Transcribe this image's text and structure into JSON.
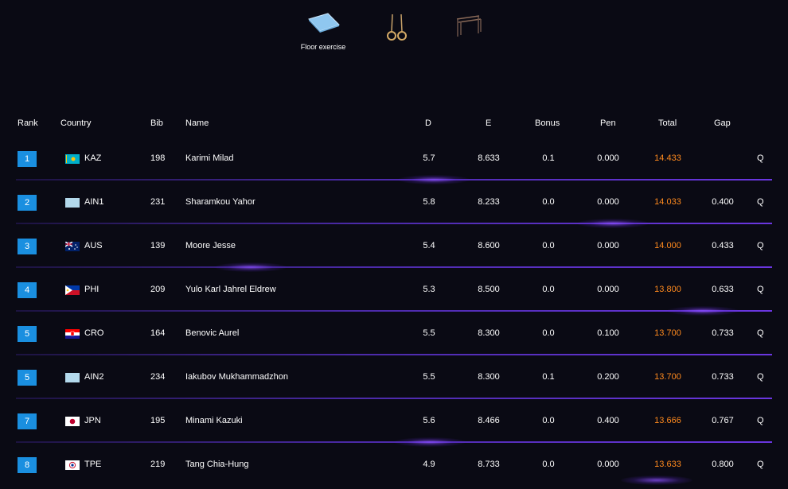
{
  "apparatus": {
    "items": [
      {
        "id": "floor",
        "label": "Floor exercise",
        "icon": "floor-mat-icon"
      },
      {
        "id": "rings",
        "label": "",
        "icon": "rings-icon"
      },
      {
        "id": "pbars",
        "label": "",
        "icon": "parallel-bars-icon"
      }
    ]
  },
  "table": {
    "headers": {
      "rank": "Rank",
      "country": "Country",
      "bib": "Bib",
      "name": "Name",
      "d": "D",
      "e": "E",
      "bonus": "Bonus",
      "pen": "Pen",
      "total": "Total",
      "gap": "Gap"
    },
    "rows": [
      {
        "rank": "1",
        "country": "KAZ",
        "bib": "198",
        "name": "Karimi Milad",
        "d": "5.7",
        "e": "8.633",
        "bonus": "0.1",
        "pen": "0.000",
        "total": "14.433",
        "gap": "",
        "q": "Q"
      },
      {
        "rank": "2",
        "country": "AIN1",
        "bib": "231",
        "name": "Sharamkou Yahor",
        "d": "5.8",
        "e": "8.233",
        "bonus": "0.0",
        "pen": "0.000",
        "total": "14.033",
        "gap": "0.400",
        "q": "Q"
      },
      {
        "rank": "3",
        "country": "AUS",
        "bib": "139",
        "name": "Moore Jesse",
        "d": "5.4",
        "e": "8.600",
        "bonus": "0.0",
        "pen": "0.000",
        "total": "14.000",
        "gap": "0.433",
        "q": "Q"
      },
      {
        "rank": "4",
        "country": "PHI",
        "bib": "209",
        "name": "Yulo Karl Jahrel Eldrew",
        "d": "5.3",
        "e": "8.500",
        "bonus": "0.0",
        "pen": "0.000",
        "total": "13.800",
        "gap": "0.633",
        "q": "Q"
      },
      {
        "rank": "5",
        "country": "CRO",
        "bib": "164",
        "name": "Benovic Aurel",
        "d": "5.5",
        "e": "8.300",
        "bonus": "0.0",
        "pen": "0.100",
        "total": "13.700",
        "gap": "0.733",
        "q": "Q"
      },
      {
        "rank": "5",
        "country": "AIN2",
        "bib": "234",
        "name": "Iakubov Mukhammadzhon",
        "d": "5.5",
        "e": "8.300",
        "bonus": "0.1",
        "pen": "0.200",
        "total": "13.700",
        "gap": "0.733",
        "q": "Q"
      },
      {
        "rank": "7",
        "country": "JPN",
        "bib": "195",
        "name": "Minami Kazuki",
        "d": "5.6",
        "e": "8.466",
        "bonus": "0.0",
        "pen": "0.400",
        "total": "13.666",
        "gap": "0.767",
        "q": "Q"
      },
      {
        "rank": "8",
        "country": "TPE",
        "bib": "219",
        "name": "Tang Chia-Hung",
        "d": "4.9",
        "e": "8.733",
        "bonus": "0.0",
        "pen": "0.000",
        "total": "13.633",
        "gap": "0.800",
        "q": "Q"
      }
    ]
  },
  "colors": {
    "background": "#0a0a14",
    "rank_badge": "#1a8fe0",
    "total_text": "#ff8a1e",
    "divider": "#6a36e0"
  }
}
